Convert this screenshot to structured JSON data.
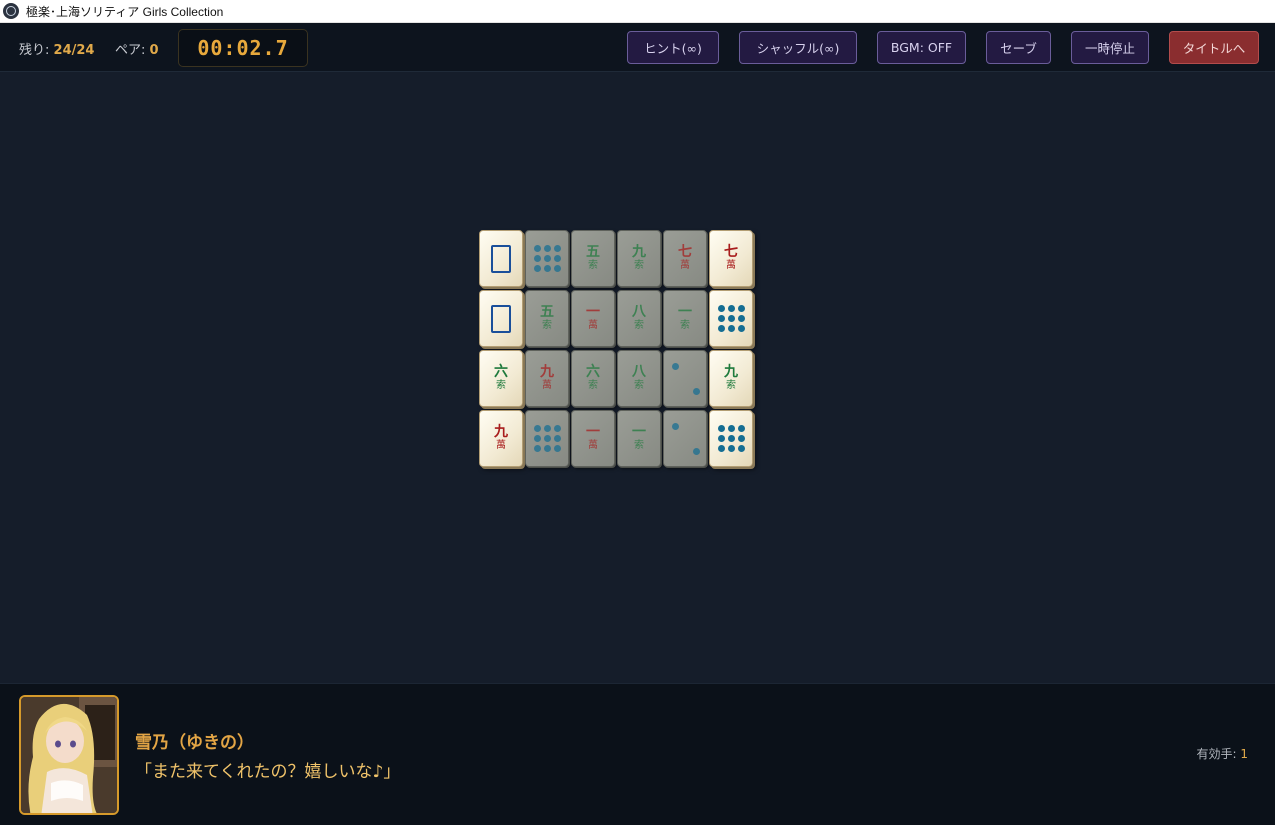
{
  "window": {
    "title": "極楽･上海ソリティア Girls Collection"
  },
  "hud": {
    "remaining_label": "残り:",
    "remaining_value": "24/24",
    "pairs_label": "ペア:",
    "pairs_value": "0",
    "timer": "00:02.7",
    "buttons": {
      "hint": "ヒント(∞)",
      "shuffle": "シャッフル(∞)",
      "bgm": "BGM: OFF",
      "save": "セーブ",
      "pause": "一時停止",
      "title": "タイトルへ"
    }
  },
  "board": {
    "rows": [
      [
        {
          "kind": "dragon",
          "free": true
        },
        {
          "kind": "dots",
          "count": 9,
          "free": false
        },
        {
          "kind": "sou",
          "num": "五",
          "suit": "索",
          "free": false
        },
        {
          "kind": "sou",
          "num": "九",
          "suit": "索",
          "free": false
        },
        {
          "kind": "man",
          "num": "七",
          "suit": "萬",
          "free": false
        },
        {
          "kind": "man",
          "num": "七",
          "suit": "萬",
          "free": true
        }
      ],
      [
        {
          "kind": "dragon",
          "free": true
        },
        {
          "kind": "sou",
          "num": "五",
          "suit": "索",
          "free": false
        },
        {
          "kind": "man",
          "num": "一",
          "suit": "萬",
          "free": false
        },
        {
          "kind": "sou",
          "num": "八",
          "suit": "索",
          "free": false
        },
        {
          "kind": "sou",
          "num": "一",
          "suit": "索",
          "free": false
        },
        {
          "kind": "dots",
          "count": 9,
          "free": true
        }
      ],
      [
        {
          "kind": "sou",
          "num": "六",
          "suit": "索",
          "free": true
        },
        {
          "kind": "man",
          "num": "九",
          "suit": "萬",
          "free": false
        },
        {
          "kind": "sou",
          "num": "六",
          "suit": "索",
          "free": false
        },
        {
          "kind": "sou",
          "num": "八",
          "suit": "索",
          "free": false
        },
        {
          "kind": "dots",
          "count": 2,
          "free": false
        },
        {
          "kind": "sou",
          "num": "九",
          "suit": "索",
          "free": true
        }
      ],
      [
        {
          "kind": "man",
          "num": "九",
          "suit": "萬",
          "free": true
        },
        {
          "kind": "dots",
          "count": 9,
          "free": false
        },
        {
          "kind": "man",
          "num": "一",
          "suit": "萬",
          "free": false
        },
        {
          "kind": "sou",
          "num": "一",
          "suit": "索",
          "free": false
        },
        {
          "kind": "dots",
          "count": 2,
          "free": false
        },
        {
          "kind": "dots",
          "count": 9,
          "free": true
        }
      ]
    ]
  },
  "dialog": {
    "speaker": "雪乃（ゆきの）",
    "line": "「また来てくれたの？嬉しいな♪」",
    "moves_label": "有効手:",
    "moves_value": "1"
  },
  "colors": {
    "accent": "#e0a94a",
    "button_bg": "#231a42",
    "danger": "#8a2d2f",
    "background": "#151d2a"
  }
}
